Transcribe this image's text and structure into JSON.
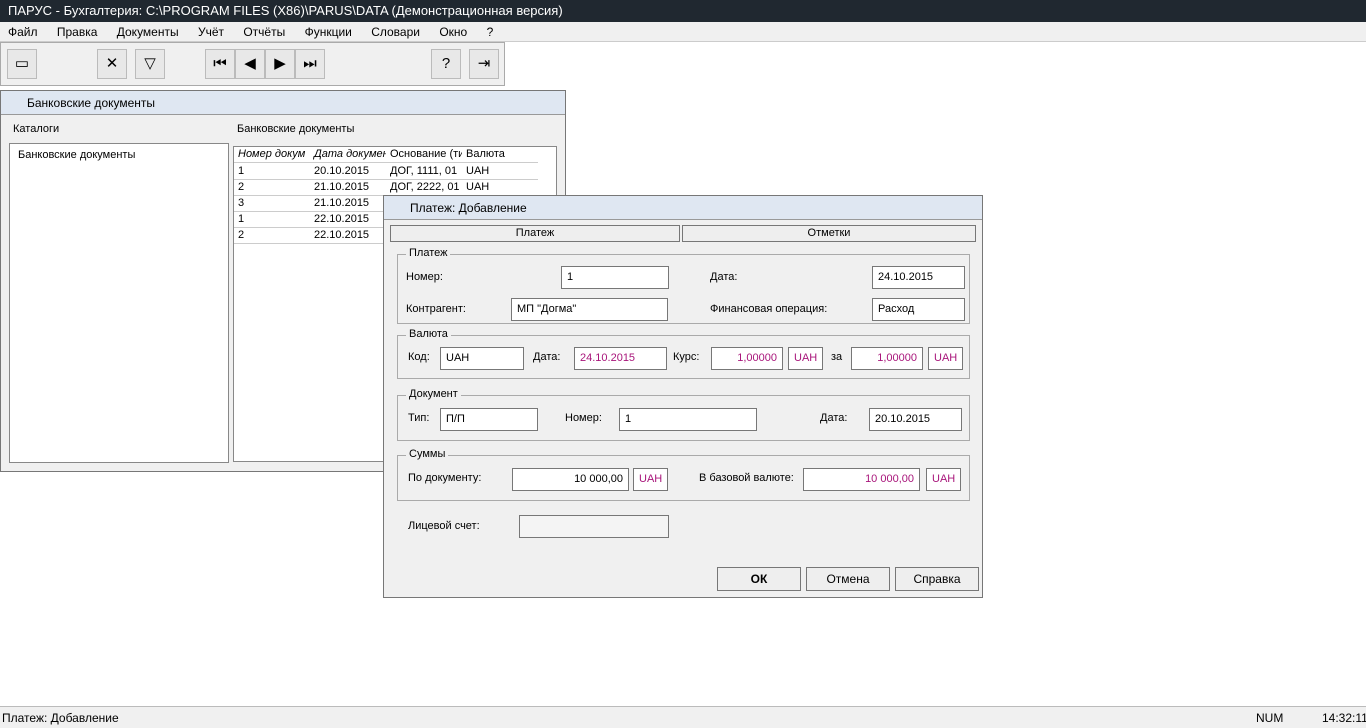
{
  "app_title": "ПАРУС - Бухгалтерия: C:\\PROGRAM FILES (X86)\\PARUS\\DATA (Демонстрационная версия)",
  "menu": [
    "Файл",
    "Правка",
    "Документы",
    "Учёт",
    "Отчёты",
    "Функции",
    "Словари",
    "Окно",
    "?"
  ],
  "bank_window": {
    "title": "Банковские документы",
    "catalog_header": "Каталоги",
    "catalog_item": "Банковские документы",
    "list_header": "Банковские документы",
    "columns": [
      "Номер докум",
      "Дата докумен",
      "Основание (ти",
      "Валюта"
    ],
    "rows": [
      [
        "1",
        "20.10.2015",
        "ДОГ, 1111, 01",
        "UAH"
      ],
      [
        "2",
        "21.10.2015",
        "ДОГ, 2222, 01",
        "UAH"
      ],
      [
        "3",
        "21.10.2015",
        "",
        ""
      ],
      [
        "1",
        "22.10.2015",
        "",
        ""
      ],
      [
        "2",
        "22.10.2015",
        "",
        ""
      ]
    ]
  },
  "dialog": {
    "title": "Платеж: Добавление",
    "tabs": [
      "Платеж",
      "Отметки"
    ],
    "payment": {
      "group": "Платеж",
      "number_label": "Номер:",
      "number": "1",
      "date_label": "Дата:",
      "date": "24.10.2015",
      "counterparty_label": "Контрагент:",
      "counterparty": "МП \"Догма\"",
      "operation_label": "Финансовая операция:",
      "operation": "Расход"
    },
    "currency": {
      "group": "Валюта",
      "code_label": "Код:",
      "code": "UAH",
      "date_label": "Дата:",
      "date": "24.10.2015",
      "rate_label": "Курс:",
      "rate": "1,00000",
      "rate_cur": "UAH",
      "for_label": "за",
      "for_value": "1,00000",
      "for_cur": "UAH"
    },
    "document": {
      "group": "Документ",
      "type_label": "Тип:",
      "type": "П/П",
      "number_label": "Номер:",
      "number": "1",
      "date_label": "Дата:",
      "date": "20.10.2015"
    },
    "sums": {
      "group": "Суммы",
      "doc_label": "По документу:",
      "doc_sum": "10 000,00",
      "doc_cur": "UAH",
      "base_label": "В базовой валюте:",
      "base_sum": "10 000,00",
      "base_cur": "UAH"
    },
    "account_label": "Лицевой счет:",
    "buttons": {
      "ok": "ОК",
      "cancel": "Отмена",
      "help": "Справка"
    }
  },
  "status": {
    "text": "Платеж: Добавление",
    "num": "NUM",
    "time": "14:32:11"
  }
}
